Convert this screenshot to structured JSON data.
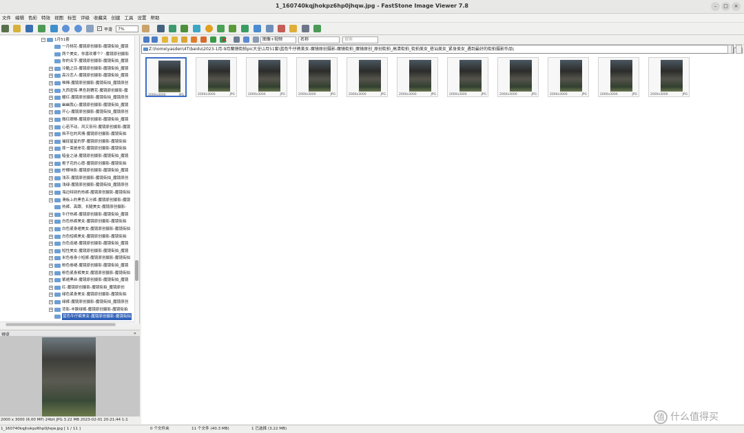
{
  "window": {
    "title": "1_160740kqjhokpz6hp0jhqw.jpg - FastStone Image Viewer 7.8"
  },
  "menu": [
    "文件",
    "编辑",
    "色彩",
    "特效",
    "视图",
    "标签",
    "评级",
    "收藏夹",
    "创建",
    "工具",
    "设置",
    "帮助"
  ],
  "toolbar": {
    "smooth_label": "平滑",
    "zoom_value": "7%"
  },
  "tree": {
    "root_label": "1月51套",
    "items": [
      {
        "label": "一月桃花-魔镜原创摄影-魔镜街拍_魔镜",
        "exp": false
      },
      {
        "label": "两个美女，你喜欢哪个？-魔镜原创摄影",
        "exp": false
      },
      {
        "label": "你的名字-魔镜原创摄影-魔镜街拍_魔镜",
        "exp": false
      },
      {
        "label": "冷酷之目-魔镜原创摄影-魔镜街拍_魔镜",
        "exp": true
      },
      {
        "label": "高冷恋人-魔镜原创摄影-魔镜街拍_魔镜",
        "exp": true
      },
      {
        "label": "唯稀-魔镜原创摄影-魔镜街拍_魔镜原创",
        "exp": true
      },
      {
        "label": "大西密探-黑色刺猬花-魔镜原创摄影-魔",
        "exp": true
      },
      {
        "label": "暖红-魔镜原创摄影-魔镜街拍_魔镜原创",
        "exp": true
      },
      {
        "label": "幽幽我心-魔镜原创摄影-魔镜街拍_魔镜",
        "exp": true
      },
      {
        "label": "开心-魔镜原创摄影-魔镜街拍_魔镜原创",
        "exp": true
      },
      {
        "label": "微红眼睛-魔镜原创摄影-魔镜街拍_魔镜",
        "exp": true
      },
      {
        "label": "心若不动，风又奈何-魔镜原创摄影-魔镜",
        "exp": true
      },
      {
        "label": "挡不住的风情-魔镜原创摄影-魔镜街拍",
        "exp": true
      },
      {
        "label": "捕捉星星的梦-魔镜原创摄影-魔镜街拍",
        "exp": true
      },
      {
        "label": "摔一束彼岸花-魔镜原创摄影-魔镜街拍",
        "exp": true
      },
      {
        "label": "暗金之谜-魔镜原创摄影-魔镜街拍_魔镜",
        "exp": true
      },
      {
        "label": "栀子花的心愿-魔镜原创摄影-魔镜街拍",
        "exp": true
      },
      {
        "label": "柠檬味影-魔镜原创摄影-魔镜街拍_魔镜",
        "exp": true
      },
      {
        "label": "浅灰-魔镜原创摄影-魔镜街拍_魔镜原创",
        "exp": true
      },
      {
        "label": "浅绿-魔镜原创摄影-魔镜街拍_魔镜原创",
        "exp": true
      },
      {
        "label": "海边特别的热裤-魔镜原创摄影-魔镜街拍",
        "exp": true
      },
      {
        "label": "滑板上的黑色五分裤-魔镜原创摄影-魔镜",
        "exp": true
      },
      {
        "label": "热裤、高跟、长腿美女-魔镜原创摄影-",
        "exp": false
      },
      {
        "label": "牛仔热裤-魔镜原创摄影-魔镜街拍_魔镜",
        "exp": true
      },
      {
        "label": "白色热裤美女-魔镜原创摄影-魔镜街拍",
        "exp": true
      },
      {
        "label": "白色紧身裙美女-魔镜原创摄影-魔镜街拍",
        "exp": true
      },
      {
        "label": "白色短裤美女-魔镜原创摄影-魔镜街拍",
        "exp": true
      },
      {
        "label": "白色连裙-魔镜原创摄影-魔镜街拍_魔镜",
        "exp": true
      },
      {
        "label": "短性美女-魔镜原创摄影-魔镜街拍_魔镜",
        "exp": true
      },
      {
        "label": "米色卷身小短裤-魔镜原创摄影-魔镜街拍",
        "exp": true
      },
      {
        "label": "粉色卷裙-魔镜原创摄影-魔镜街拍_魔镜",
        "exp": true
      },
      {
        "label": "粉色紧身裤美女-魔镜原创摄影-魔镜街拍",
        "exp": true
      },
      {
        "label": "紫裙黑丝-魔镜原创摄影-魔镜街拍_魔镜",
        "exp": true
      },
      {
        "label": "红-魔镜原创摄影-魔镜街拍_魔镜原创",
        "exp": true
      },
      {
        "label": "绿色紧身美女-魔镜原创摄影-魔镜街拍",
        "exp": true
      },
      {
        "label": "绿裤-魔镜原创摄影-魔镜街拍_魔镜原创",
        "exp": true
      },
      {
        "label": "背影-丰腴绿裤-魔镜原创摄影-魔镜街拍",
        "exp": true
      },
      {
        "label": "蓝色牛仔裤美女-魔镜原创摄影-魔镜街拍",
        "exp": false,
        "selected": true
      }
    ]
  },
  "preview": {
    "header": "预览",
    "status": "2000 x 3000 (6.00 MP)  24bit  JPG   3.22 MB   2023-02-01 20:21:44  1:1"
  },
  "rtool": {
    "sort_label": "图像+视频",
    "sort_by": "名称",
    "search_placeholder": "搜索"
  },
  "path": "Z:\\home\\yasden\\4T\\baidu\\2023-1月-9月魔镜街拍pic大全\\1月51套\\蓝色牛仔裤美女-魔镜原创摄影-魔镜街拍_魔镜原创_原创街拍_高清街拍_街拍美女_搭讪美女_紧身美女_遇到最好的街拍摄影作品\\",
  "thumbs": [
    {
      "dim": "2000x3000",
      "ext": "JPG",
      "selected": true
    },
    {
      "dim": "2000x3000",
      "ext": "JPG"
    },
    {
      "dim": "2000x3000",
      "ext": "JPG"
    },
    {
      "dim": "2000x3000",
      "ext": "JPG"
    },
    {
      "dim": "2000x3000",
      "ext": "JPG"
    },
    {
      "dim": "2000x3000",
      "ext": "JPG"
    },
    {
      "dim": "2000x3000",
      "ext": "JPG"
    },
    {
      "dim": "2000x3000",
      "ext": "JPG"
    },
    {
      "dim": "2000x3000",
      "ext": "JPG"
    },
    {
      "dim": "2000x3000",
      "ext": "JPG"
    },
    {
      "dim": "2000x3000",
      "ext": "JPG"
    }
  ],
  "status": {
    "file": "1_160740kqjhokpz6hp0jhqw.jpg [ 1 / 11 ]",
    "folders": "0 个文件夹",
    "files": "11 个文件 (40.3 MB)",
    "selected": "1 已选择 (3.22 MB)"
  },
  "watermark": {
    "glyph": "值",
    "text": "什么值得买"
  }
}
